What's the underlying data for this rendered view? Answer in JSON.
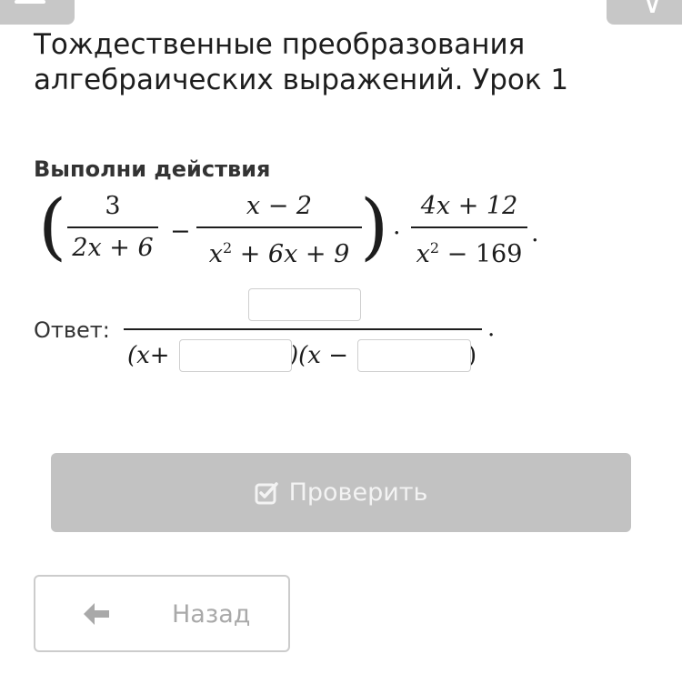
{
  "header": {
    "menu_icon": "menu-icon",
    "close_icon": "close-icon"
  },
  "lesson": {
    "title": "Тождественные преобразования алгебраических выражений. Урок 1"
  },
  "task": {
    "instruction": "Выполни действия",
    "expression": {
      "frac1_num": "3",
      "frac1_den": "2x + 6",
      "minus": "−",
      "frac2_num": "x − 2",
      "frac2_den_a": "x",
      "frac2_den_exp": "2",
      "frac2_den_b": " + 6x + 9",
      "dot": "·",
      "frac3_num": "4x + 12",
      "frac3_den_a": "x",
      "frac3_den_exp": "2",
      "frac3_den_b": " − 169",
      "end": "."
    }
  },
  "answer": {
    "label": "Ответ:",
    "numerator_value": "",
    "den_part1": "(x+",
    "den_part2": ")(x −",
    "den_part3": ")",
    "den_value1": "",
    "den_value2": "",
    "end": "."
  },
  "buttons": {
    "check_label": "Проверить",
    "back_label": "Назад"
  },
  "colors": {
    "disabled_button": "#c2c2c2",
    "border": "#cccccc",
    "muted_text": "#a9a9a9"
  }
}
